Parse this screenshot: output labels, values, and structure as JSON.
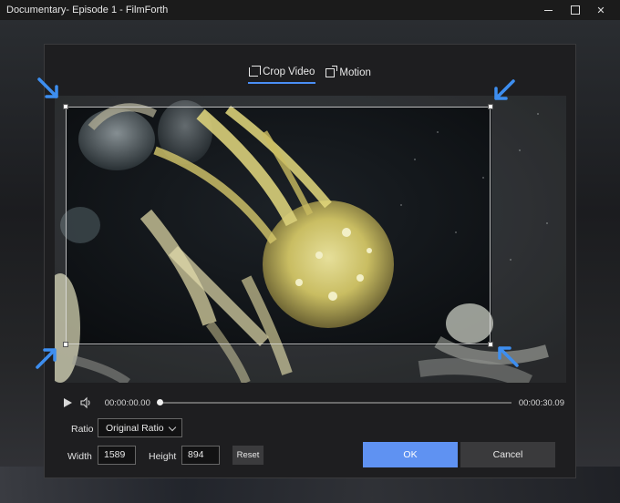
{
  "window": {
    "title": "Documentary- Episode 1 - FilmForth",
    "controls": [
      "minimize",
      "maximize",
      "close"
    ]
  },
  "tabs": [
    {
      "label": "Crop Video",
      "icon": "crop-icon",
      "active": true
    },
    {
      "label": "Motion",
      "icon": "motion-icon",
      "active": false
    }
  ],
  "playback": {
    "current_time": "00:00:00.00",
    "end_time": "00:00:30.09",
    "progress": 0.0
  },
  "ratio": {
    "label": "Ratio",
    "value": "Original Ratio"
  },
  "size": {
    "width_label": "Width",
    "width_value": "1589",
    "height_label": "Height",
    "height_value": "894"
  },
  "buttons": {
    "reset": "Reset",
    "ok": "OK",
    "cancel": "Cancel"
  },
  "colors": {
    "accent": "#5f92f2",
    "annotation_arrow": "#3d8ef0"
  }
}
